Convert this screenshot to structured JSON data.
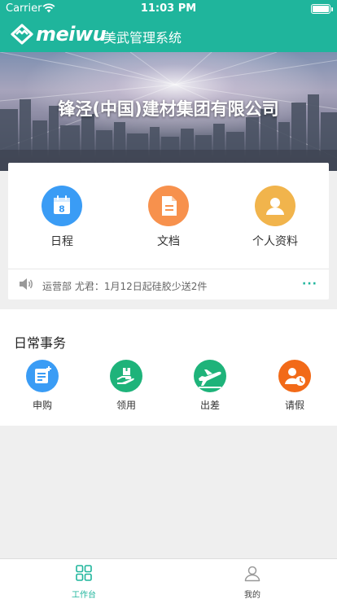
{
  "status_bar": {
    "carrier": "Carrier",
    "time": "11:03 PM"
  },
  "app_bar": {
    "logo_text": "meiwu",
    "title": "美武管理系统",
    "colors": {
      "primary": "#1fb59c"
    }
  },
  "banner": {
    "company_name": "锋泾(中国)建材集团有限公司"
  },
  "quick_actions": [
    {
      "label": "日程",
      "icon": "calendar-icon",
      "color": "#3a9cf5",
      "calendar_day": "8"
    },
    {
      "label": "文档",
      "icon": "document-icon",
      "color": "#f7914d"
    },
    {
      "label": "个人资料",
      "icon": "user-profile-icon",
      "color": "#f1b44c"
    }
  ],
  "notice": {
    "icon": "speaker-icon",
    "text": "运营部 尤君：1月12日起硅胶少送2件",
    "more": "···"
  },
  "daily_affairs": {
    "heading": "日常事务",
    "items": [
      {
        "label": "申购",
        "icon": "purchase-request-icon",
        "color": "#3a9cf5"
      },
      {
        "label": "领用",
        "icon": "requisition-icon",
        "color": "#1eb37a"
      },
      {
        "label": "出差",
        "icon": "airplane-icon",
        "color": "#1eb37a"
      },
      {
        "label": "请假",
        "icon": "leave-request-icon",
        "color": "#f26a18"
      }
    ]
  },
  "tab_bar": {
    "tabs": [
      {
        "label": "工作台",
        "icon": "workbench-grid-icon",
        "active": true
      },
      {
        "label": "我的",
        "icon": "user-icon",
        "active": false
      }
    ]
  }
}
